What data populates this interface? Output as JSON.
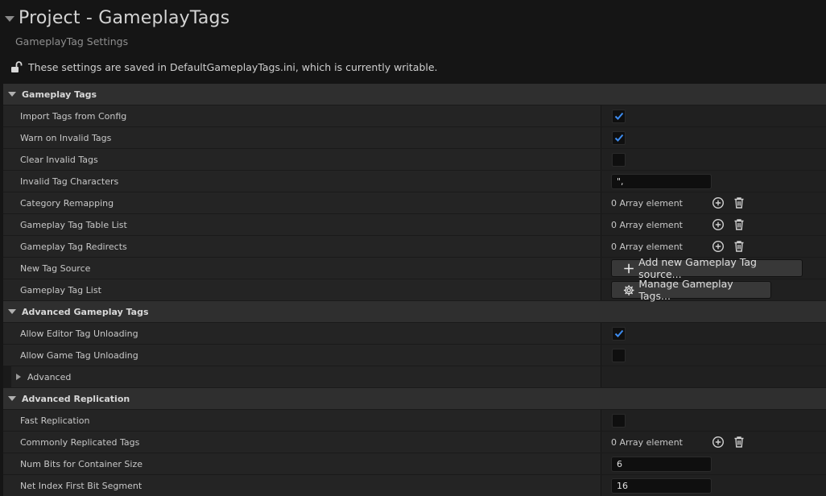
{
  "header": {
    "title": "Project - GameplayTags",
    "subtitle": "GameplayTag Settings",
    "writable_notice": "These settings are saved in DefaultGameplayTags.ini, which is currently writable."
  },
  "categories": {
    "gameplay_tags": "Gameplay Tags",
    "advanced_gameplay_tags": "Advanced Gameplay Tags",
    "advanced_replication": "Advanced Replication"
  },
  "properties": {
    "import_tags_from_config": {
      "label": "Import Tags from Config",
      "checked": true
    },
    "warn_on_invalid_tags": {
      "label": "Warn on Invalid Tags",
      "checked": true
    },
    "clear_invalid_tags": {
      "label": "Clear Invalid Tags",
      "checked": false
    },
    "invalid_tag_characters": {
      "label": "Invalid Tag Characters",
      "value": "\",",
      "value_display": "\","
    },
    "category_remapping": {
      "label": "Category Remapping",
      "value": "0 Array element"
    },
    "gameplay_tag_table_list": {
      "label": "Gameplay Tag Table List",
      "value": "0 Array element"
    },
    "gameplay_tag_redirects": {
      "label": "Gameplay Tag Redirects",
      "value": "0 Array element"
    },
    "new_tag_source": {
      "label": "New Tag Source",
      "button": "Add new Gameplay Tag source..."
    },
    "gameplay_tag_list": {
      "label": "Gameplay Tag List",
      "button": "Manage Gameplay Tags..."
    },
    "allow_editor_tag_unloading": {
      "label": "Allow Editor Tag Unloading",
      "checked": true
    },
    "allow_game_tag_unloading": {
      "label": "Allow Game Tag Unloading",
      "checked": false
    },
    "advanced": {
      "label": "Advanced"
    },
    "fast_replication": {
      "label": "Fast Replication",
      "checked": false
    },
    "commonly_replicated_tags": {
      "label": "Commonly Replicated Tags",
      "value": "0 Array element"
    },
    "num_bits_for_container_size": {
      "label": "Num Bits for Container Size",
      "value": "6"
    },
    "net_index_first_bit_segment": {
      "label": "Net Index First Bit Segment",
      "value": "16"
    }
  },
  "icons": {
    "lock": "unlocked-padlock-icon",
    "add": "plus-circle-icon",
    "delete": "trash-icon",
    "settings": "gear-icon"
  },
  "colors": {
    "background": "#151515",
    "category_row": "#2f2f2f",
    "property_row": "#242424",
    "checkmark": "#3d8cf0"
  }
}
